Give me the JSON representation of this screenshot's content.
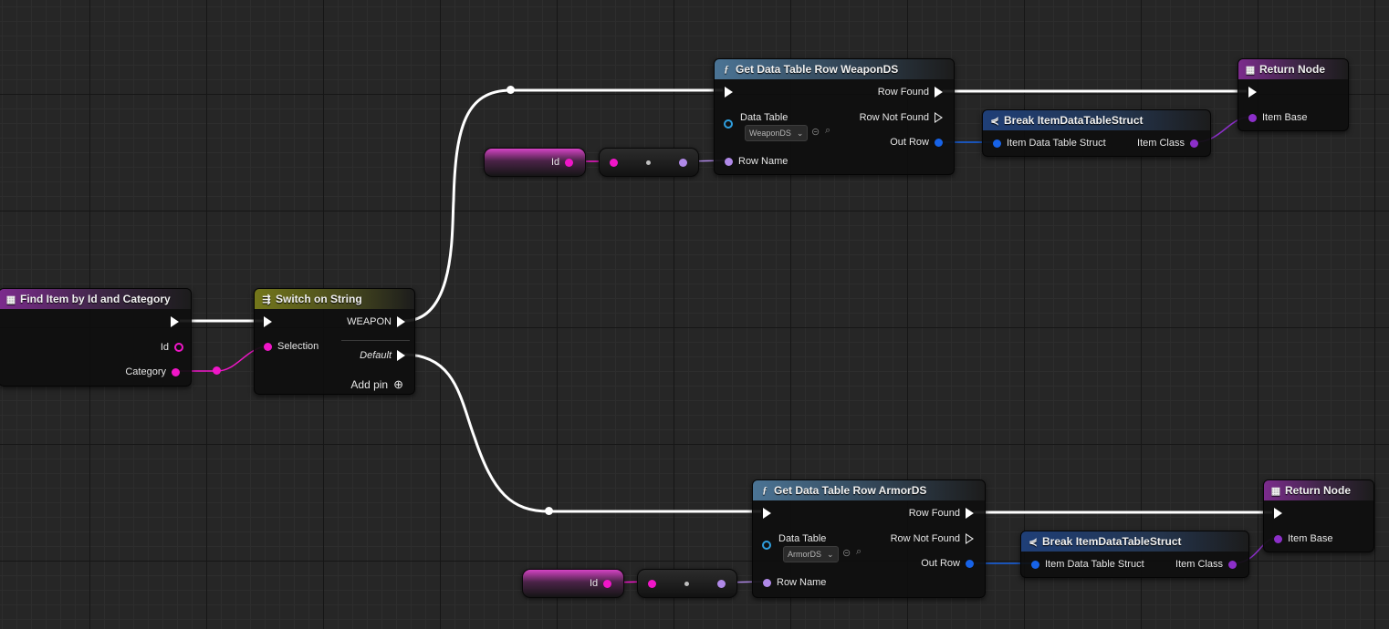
{
  "colors": {
    "exec": "#ffffff",
    "string_pin": "#f016c8",
    "name_pin": "#b089e8",
    "struct_pin": "#1763e8",
    "object_pin": "#8c2fc9",
    "grid_bg": "#262626"
  },
  "nodes": {
    "find_item": {
      "title": "Find Item by Id and Category",
      "icon": "function-entry-icon",
      "pins": {
        "id": "Id",
        "category": "Category"
      }
    },
    "switch": {
      "title": "Switch on String",
      "pins": {
        "selection": "Selection",
        "weapon": "WEAPON",
        "default": "Default",
        "add_pin": "Add pin"
      }
    },
    "get_weapon": {
      "title": "Get Data Table Row WeaponDS",
      "pins": {
        "row_found": "Row Found",
        "row_not_found": "Row Not Found",
        "data_table": "Data Table",
        "table_value": "WeaponDS",
        "out_row": "Out Row",
        "row_name": "Row Name"
      }
    },
    "get_armor": {
      "title": "Get Data Table Row ArmorDS",
      "pins": {
        "row_found": "Row Found",
        "row_not_found": "Row Not Found",
        "data_table": "Data Table",
        "table_value": "ArmorDS",
        "out_row": "Out Row",
        "row_name": "Row Name"
      }
    },
    "break_top": {
      "title": "Break ItemDataTableStruct",
      "pins": {
        "in": "Item Data Table Struct",
        "out": "Item Class"
      }
    },
    "break_bottom": {
      "title": "Break ItemDataTableStruct",
      "pins": {
        "in": "Item Data Table Struct",
        "out": "Item Class"
      }
    },
    "return_top": {
      "title": "Return Node",
      "pins": {
        "item_base": "Item Base"
      }
    },
    "return_bottom": {
      "title": "Return Node",
      "pins": {
        "item_base": "Item Base"
      }
    },
    "id_var_top": {
      "label": "Id"
    },
    "id_var_bottom": {
      "label": "Id"
    }
  }
}
